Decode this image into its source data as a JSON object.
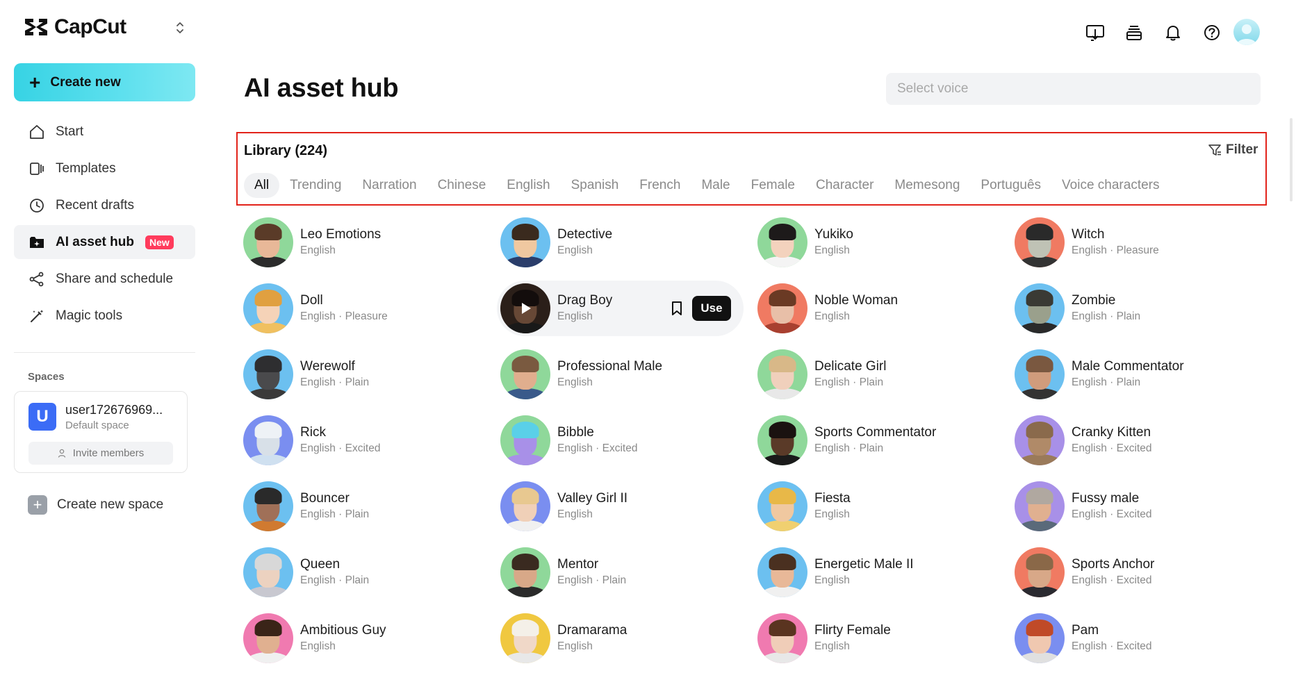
{
  "app": {
    "name": "CapCut"
  },
  "sidebar": {
    "create_label": "Create new",
    "items": [
      {
        "label": "Start",
        "icon": "home-icon"
      },
      {
        "label": "Templates",
        "icon": "templates-icon"
      },
      {
        "label": "Recent drafts",
        "icon": "clock-icon"
      },
      {
        "label": "AI asset hub",
        "icon": "ai-hub-icon",
        "badge": "New"
      },
      {
        "label": "Share and schedule",
        "icon": "share-icon"
      },
      {
        "label": "Magic tools",
        "icon": "magic-wand-icon"
      }
    ],
    "spaces_title": "Spaces",
    "space": {
      "initial": "U",
      "name": "user172676969...",
      "type": "Default space",
      "invite_label": "Invite members"
    },
    "new_space_label": "Create new space"
  },
  "header": {
    "icons": [
      "download-monitor-icon",
      "layers-icon",
      "bell-icon",
      "help-icon"
    ],
    "avatar": "user-avatar"
  },
  "main": {
    "title": "AI asset hub",
    "voice_placeholder": "Select voice",
    "library_title": "Library (224)",
    "filter_label": "Filter",
    "tabs": [
      "All",
      "Trending",
      "Narration",
      "Chinese",
      "English",
      "Spanish",
      "French",
      "Male",
      "Female",
      "Character",
      "Memesong",
      "Português",
      "Voice characters"
    ],
    "active_tab": "All",
    "use_label": "Use",
    "voices": [
      {
        "name": "Leo Emotions",
        "meta": "English",
        "bg": "#8fd89a",
        "skin": "#e8b898",
        "hair": "#5a3b28",
        "cloth": "#2b2b2b"
      },
      {
        "name": "Detective",
        "meta": "English",
        "bg": "#6cc0f0",
        "skin": "#f0c8a0",
        "hair": "#3a2a1e",
        "cloth": "#2a3d6a"
      },
      {
        "name": "Yukiko",
        "meta": "English",
        "bg": "#8fd89a",
        "skin": "#f3d2bd",
        "hair": "#1d1a1a",
        "cloth": "#f4f4f4"
      },
      {
        "name": "Witch",
        "meta": "English · Pleasure",
        "bg": "#f07a62",
        "skin": "#bfc2b5",
        "hair": "#2a2a2a",
        "cloth": "#333333"
      },
      {
        "name": "Doll",
        "meta": "English · Pleasure",
        "bg": "#6cc0f0",
        "skin": "#f5d3b8",
        "hair": "#e0a040",
        "cloth": "#f0c060"
      },
      {
        "name": "Drag Boy",
        "meta": "English",
        "bg": "#3a2a22",
        "skin": "#8a6048",
        "hair": "#1a1210",
        "cloth": "#222222"
      },
      {
        "name": "Noble Woman",
        "meta": "English",
        "bg": "#f07a62",
        "skin": "#e8bfa8",
        "hair": "#6a3a24",
        "cloth": "#a84030"
      },
      {
        "name": "Zombie",
        "meta": "English · Plain",
        "bg": "#6cc0f0",
        "skin": "#9aa08c",
        "hair": "#3a3a34",
        "cloth": "#2a2a2a"
      },
      {
        "name": "Werewolf",
        "meta": "English · Plain",
        "bg": "#6cc0f0",
        "skin": "#4a4a4c",
        "hair": "#2e2e30",
        "cloth": "#3a3a3a"
      },
      {
        "name": "Professional Male",
        "meta": "English",
        "bg": "#8fd89a",
        "skin": "#e0ae8e",
        "hair": "#7a5a40",
        "cloth": "#3a5a8a"
      },
      {
        "name": "Delicate Girl",
        "meta": "English · Plain",
        "bg": "#8fd89a",
        "skin": "#f0d0bc",
        "hair": "#d8b888",
        "cloth": "#e8e8e8"
      },
      {
        "name": "Male Commentator",
        "meta": "English · Plain",
        "bg": "#6cc0f0",
        "skin": "#d09c7c",
        "hair": "#7a5840",
        "cloth": "#333333"
      },
      {
        "name": "Rick",
        "meta": "English · Excited",
        "bg": "#7a8ef0",
        "skin": "#d8e0e8",
        "hair": "#eef2f6",
        "cloth": "#cfe0f0"
      },
      {
        "name": "Bibble",
        "meta": "English · Excited",
        "bg": "#8fd89a",
        "skin": "#a890e8",
        "hair": "#5ad0e8",
        "cloth": "#a890e8"
      },
      {
        "name": "Sports Commentator",
        "meta": "English · Plain",
        "bg": "#8fd89a",
        "skin": "#5a3a28",
        "hair": "#1a1210",
        "cloth": "#1a1a1a"
      },
      {
        "name": "Cranky Kitten",
        "meta": "English · Excited",
        "bg": "#a890e8",
        "skin": "#b08a68",
        "hair": "#8a6a4c",
        "cloth": "#9a7a5a"
      },
      {
        "name": "Bouncer",
        "meta": "English · Plain",
        "bg": "#6cc0f0",
        "skin": "#a07058",
        "hair": "#2a2a2a",
        "cloth": "#d07a30"
      },
      {
        "name": "Valley Girl II",
        "meta": "English",
        "bg": "#7a8ef0",
        "skin": "#f0d0b8",
        "hair": "#e8c890",
        "cloth": "#f0f0f0"
      },
      {
        "name": "Fiesta",
        "meta": "English",
        "bg": "#6cc0f0",
        "skin": "#f0c8a0",
        "hair": "#e8b848",
        "cloth": "#f0d070"
      },
      {
        "name": "Fussy male",
        "meta": "English · Excited",
        "bg": "#a890e8",
        "skin": "#e0b090",
        "hair": "#b0a8a0",
        "cloth": "#5a6a7a"
      },
      {
        "name": "Queen",
        "meta": "English · Plain",
        "bg": "#6cc0f0",
        "skin": "#ecd2c0",
        "hair": "#d8d8d8",
        "cloth": "#c8c8d0"
      },
      {
        "name": "Mentor",
        "meta": "English · Plain",
        "bg": "#8fd89a",
        "skin": "#d8a888",
        "hair": "#3a2a20",
        "cloth": "#2a2a2a"
      },
      {
        "name": "Energetic Male II",
        "meta": "English",
        "bg": "#6cc0f0",
        "skin": "#e8b898",
        "hair": "#4a3020",
        "cloth": "#f0f0f0"
      },
      {
        "name": "Sports Anchor",
        "meta": "English · Excited",
        "bg": "#f07a62",
        "skin": "#d8a888",
        "hair": "#8a6848",
        "cloth": "#2a2a30"
      },
      {
        "name": "Ambitious Guy",
        "meta": "English",
        "bg": "#f07ab0",
        "skin": "#e0b090",
        "hair": "#3a2418",
        "cloth": "#f0f0f0"
      },
      {
        "name": "Dramarama",
        "meta": "English",
        "bg": "#f0c840",
        "skin": "#f0d8c8",
        "hair": "#f4f0e8",
        "cloth": "#e8e8e8"
      },
      {
        "name": "Flirty Female",
        "meta": "English",
        "bg": "#f07ab0",
        "skin": "#f0cdb8",
        "hair": "#5a3420",
        "cloth": "#e8e8e8"
      },
      {
        "name": "Pam",
        "meta": "English · Excited",
        "bg": "#7a8ef0",
        "skin": "#f0c8b0",
        "hair": "#c04a28",
        "cloth": "#e0e0e0"
      }
    ]
  }
}
